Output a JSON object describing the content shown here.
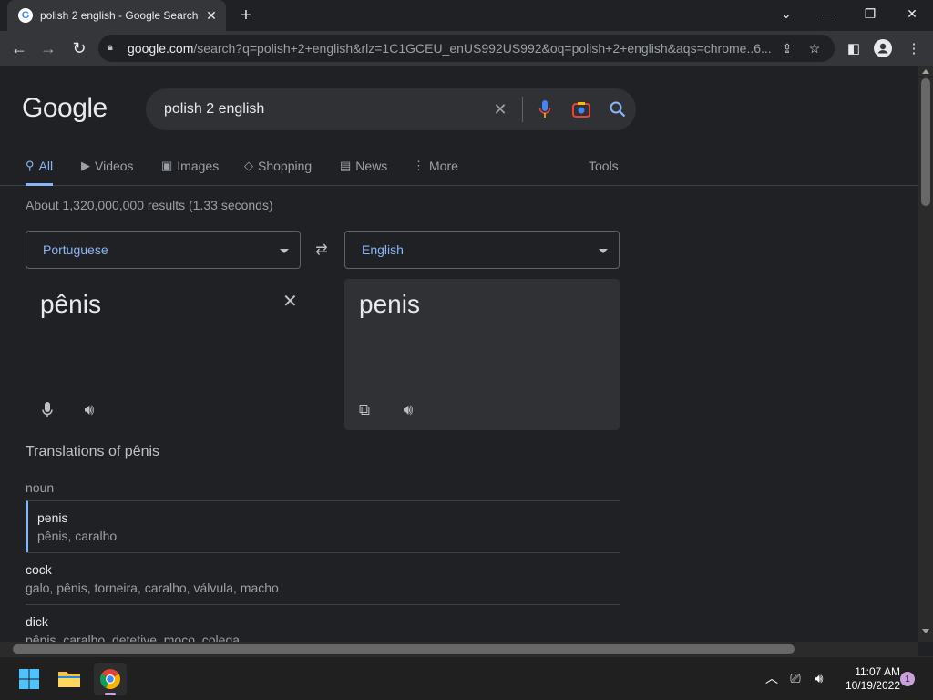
{
  "browser": {
    "tab_title": "polish 2 english - Google Search",
    "favicon": "G",
    "url_host": "google.com",
    "url_rest": "/search?q=polish+2+english&rlz=1C1GCEU_enUS992US992&oq=polish+2+english&aqs=chrome..6..."
  },
  "google": {
    "logo": "Google",
    "query": "polish 2 english",
    "tabs": [
      {
        "label": "All",
        "icon": "search-icon"
      },
      {
        "label": "Videos",
        "icon": "play-icon"
      },
      {
        "label": "Images",
        "icon": "image-icon"
      },
      {
        "label": "Shopping",
        "icon": "tag-icon"
      },
      {
        "label": "News",
        "icon": "newspaper-icon"
      },
      {
        "label": "More",
        "icon": "more-vertical-icon"
      }
    ],
    "tools": "Tools",
    "stats": "About 1,320,000,000 results (1.33 seconds)"
  },
  "translate": {
    "source_lang": "Portuguese",
    "target_lang": "English",
    "source_text": "pênis",
    "target_text": "penis",
    "translations_heading": "Translations of pênis",
    "pos": "noun",
    "entries": [
      {
        "word": "penis",
        "synonyms": "pênis, caralho"
      },
      {
        "word": "cock",
        "synonyms": "galo, pênis, torneira, caralho, válvula, macho"
      },
      {
        "word": "dick",
        "synonyms": "pênis, caralho, detetive, moço, colega"
      }
    ]
  },
  "taskbar": {
    "time": "11:07 AM",
    "date": "10/19/2022",
    "notifications": "1"
  },
  "colors": {
    "accent": "#8ab4f8",
    "background": "#202124",
    "surface": "#303134"
  }
}
